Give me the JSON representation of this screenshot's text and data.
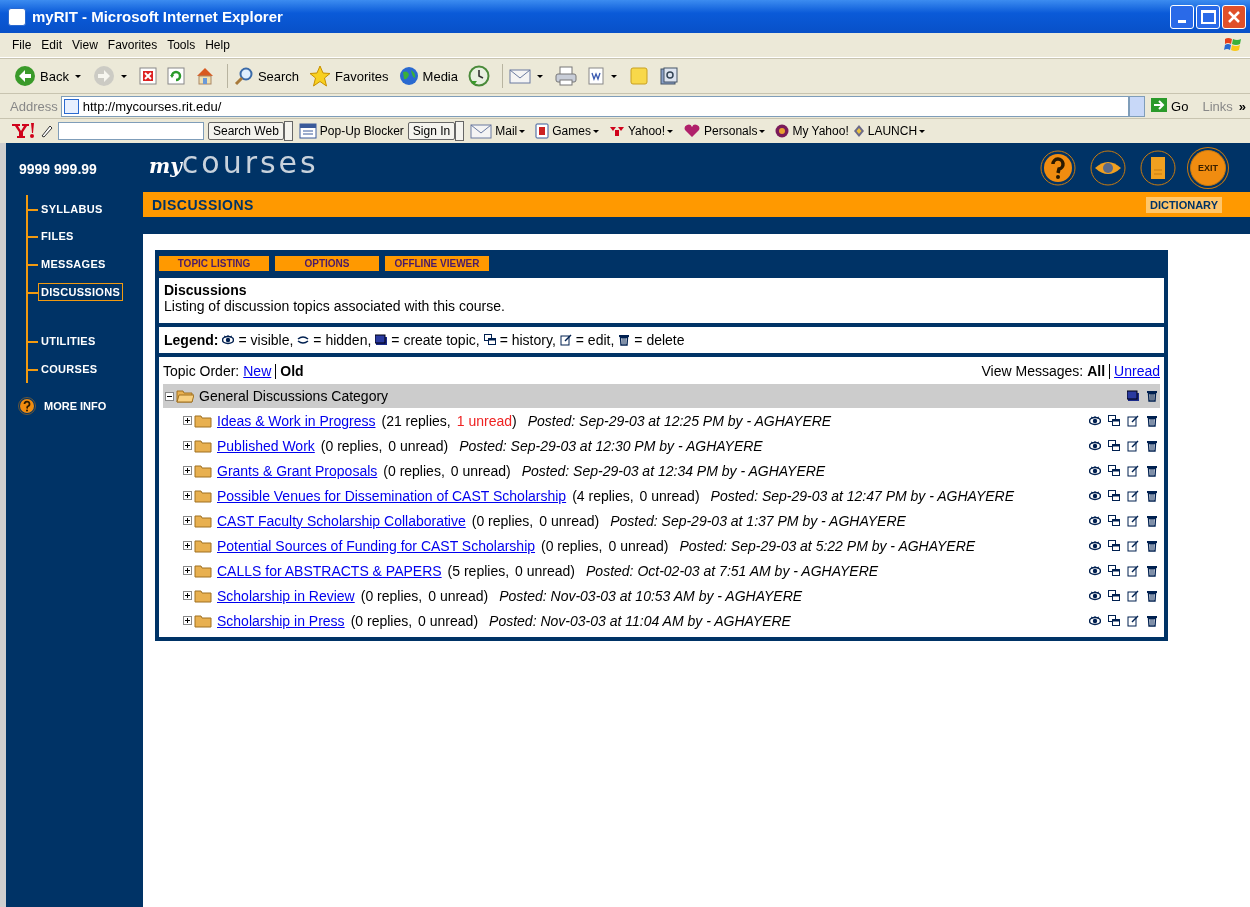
{
  "window": {
    "title": "myRIT - Microsoft Internet Explorer"
  },
  "menu": [
    "File",
    "Edit",
    "View",
    "Favorites",
    "Tools",
    "Help"
  ],
  "toolbar": [
    {
      "kind": "back",
      "label": "Back",
      "dropdown": true,
      "disabled": false
    },
    {
      "kind": "forward",
      "dropdown": true,
      "disabled": true
    },
    {
      "kind": "stop",
      "dropdown": false,
      "disabled": false
    },
    {
      "kind": "refresh",
      "dropdown": false,
      "disabled": false
    },
    {
      "kind": "home",
      "dropdown": false,
      "disabled": false
    },
    {
      "kind": "search",
      "label": "Search",
      "dropdown": false,
      "disabled": false
    },
    {
      "kind": "favorites",
      "label": "Favorites",
      "dropdown": false,
      "disabled": false
    },
    {
      "kind": "media",
      "label": "Media",
      "dropdown": false,
      "disabled": false
    },
    {
      "kind": "history",
      "dropdown": false,
      "disabled": false
    },
    {
      "kind": "mail",
      "dropdown": true,
      "disabled": false
    },
    {
      "kind": "print",
      "dropdown": false,
      "disabled": false
    },
    {
      "kind": "edit",
      "dropdown": true,
      "disabled": false
    },
    {
      "kind": "messenger",
      "dropdown": false,
      "disabled": false
    },
    {
      "kind": "research",
      "dropdown": false,
      "disabled": false
    }
  ],
  "address": {
    "label": "Address",
    "url": "http://mycourses.rit.edu/",
    "go": "Go",
    "links": "Links",
    "more": "»"
  },
  "yahoo_bar": {
    "search_button": "Search Web",
    "items": [
      {
        "kind": "popup",
        "label": "Pop-Up Blocker",
        "dropdown": false
      },
      {
        "kind": "signin",
        "label": "Sign In",
        "dropdown": true
      },
      {
        "kind": "mail",
        "label": "Mail",
        "dropdown": true
      },
      {
        "kind": "games",
        "label": "Games",
        "dropdown": true
      },
      {
        "kind": "yahoo",
        "label": "Yahoo!",
        "dropdown": true
      },
      {
        "kind": "personals",
        "label": "Personals",
        "dropdown": true
      },
      {
        "kind": "myyahoo",
        "label": "My Yahoo!",
        "dropdown": false
      },
      {
        "kind": "launch",
        "label": "LAUNCH",
        "dropdown": true
      }
    ]
  },
  "site": {
    "course_code": "9999 999.99",
    "logo": {
      "script": "my",
      "main": "courses"
    },
    "header_icons": [
      {
        "kind": "help"
      },
      {
        "kind": "eye"
      },
      {
        "kind": "book"
      },
      {
        "kind": "exit",
        "label": "EXIT"
      }
    ],
    "nav_groups": [
      [
        {
          "label": "SYLLABUS",
          "selected": false
        },
        {
          "label": "FILES",
          "selected": false
        },
        {
          "label": "MESSAGES",
          "selected": false
        },
        {
          "label": "DISCUSSIONS",
          "selected": true
        }
      ],
      [
        {
          "label": "UTILITIES",
          "selected": false
        },
        {
          "label": "COURSES",
          "selected": false
        }
      ]
    ],
    "more_info": "MORE INFO",
    "section_title": "DISCUSSIONS",
    "dictionary": "DICTIONARY"
  },
  "panel": {
    "tabs": [
      "TOPIC LISTING",
      "OPTIONS",
      "OFFLINE VIEWER"
    ],
    "description": {
      "title": "Discussions",
      "text": "Listing of discussion topics associated with this course."
    },
    "legend": {
      "label": "Legend:",
      "items": [
        {
          "kind": "visible",
          "text": "= visible,"
        },
        {
          "kind": "hidden",
          "text": "= hidden,"
        },
        {
          "kind": "create",
          "text": "= create topic,"
        },
        {
          "kind": "history",
          "text": "= history,"
        },
        {
          "kind": "edit",
          "text": "= edit,"
        },
        {
          "kind": "delete",
          "text": "= delete"
        }
      ]
    },
    "topic_order": {
      "label": "Topic Order:",
      "options": [
        {
          "label": "New",
          "selected": false
        },
        {
          "label": "Old",
          "selected": true
        }
      ]
    },
    "view_messages": {
      "label": "View Messages:",
      "options": [
        {
          "label": "All",
          "selected": true
        },
        {
          "label": "Unread",
          "selected": false
        }
      ]
    },
    "category": {
      "name": "General Discussions Category",
      "expanded": true,
      "topics": [
        {
          "title": "Ideas & Work in Progress",
          "replies": "(21 replies,",
          "unread": "1 unread",
          "has_unread": true,
          "close": ")",
          "posted": "Posted: Sep-29-03 at 12:25 PM by - AGHAYERE",
          "expanded": false
        },
        {
          "title": "Published Work",
          "replies": "(0 replies,",
          "unread": "0 unread",
          "has_unread": false,
          "close": ")",
          "posted": "Posted: Sep-29-03 at 12:30 PM by - AGHAYERE",
          "expanded": false
        },
        {
          "title": "Grants & Grant Proposals",
          "replies": "(0 replies,",
          "unread": "0 unread",
          "has_unread": false,
          "close": ")",
          "posted": "Posted: Sep-29-03 at 12:34 PM by - AGHAYERE",
          "expanded": false
        },
        {
          "title": "Possible Venues for Dissemination of CAST Scholarship",
          "replies": "(4 replies,",
          "unread": "0 unread",
          "has_unread": false,
          "close": ")",
          "posted": "Posted: Sep-29-03 at 12:47 PM by - AGHAYERE",
          "expanded": false
        },
        {
          "title": "CAST Faculty Scholarship Collaborative",
          "replies": "(0 replies,",
          "unread": "0 unread",
          "has_unread": false,
          "close": ")",
          "posted": "Posted: Sep-29-03 at 1:37 PM by - AGHAYERE",
          "expanded": false
        },
        {
          "title": "Potential Sources of Funding for CAST Scholarship",
          "replies": "(0 replies,",
          "unread": "0 unread",
          "has_unread": false,
          "close": ")",
          "posted": "Posted: Sep-29-03 at 5:22 PM by - AGHAYERE",
          "expanded": false
        },
        {
          "title": "CALLS for ABSTRACTS & PAPERS",
          "replies": "(5 replies,",
          "unread": "0 unread",
          "has_unread": false,
          "close": ")",
          "posted": "Posted: Oct-02-03 at 7:51 AM by - AGHAYERE",
          "expanded": false
        },
        {
          "title": "Scholarship in Review",
          "replies": "(0 replies,",
          "unread": "0 unread",
          "has_unread": false,
          "close": ")",
          "posted": "Posted: Nov-03-03 at 10:53 AM by - AGHAYERE",
          "expanded": false
        },
        {
          "title": "Scholarship in Press",
          "replies": "(0 replies,",
          "unread": "0 unread",
          "has_unread": false,
          "close": ")",
          "posted": "Posted: Nov-03-03 at 11:04 AM by - AGHAYERE",
          "expanded": false
        }
      ]
    }
  }
}
